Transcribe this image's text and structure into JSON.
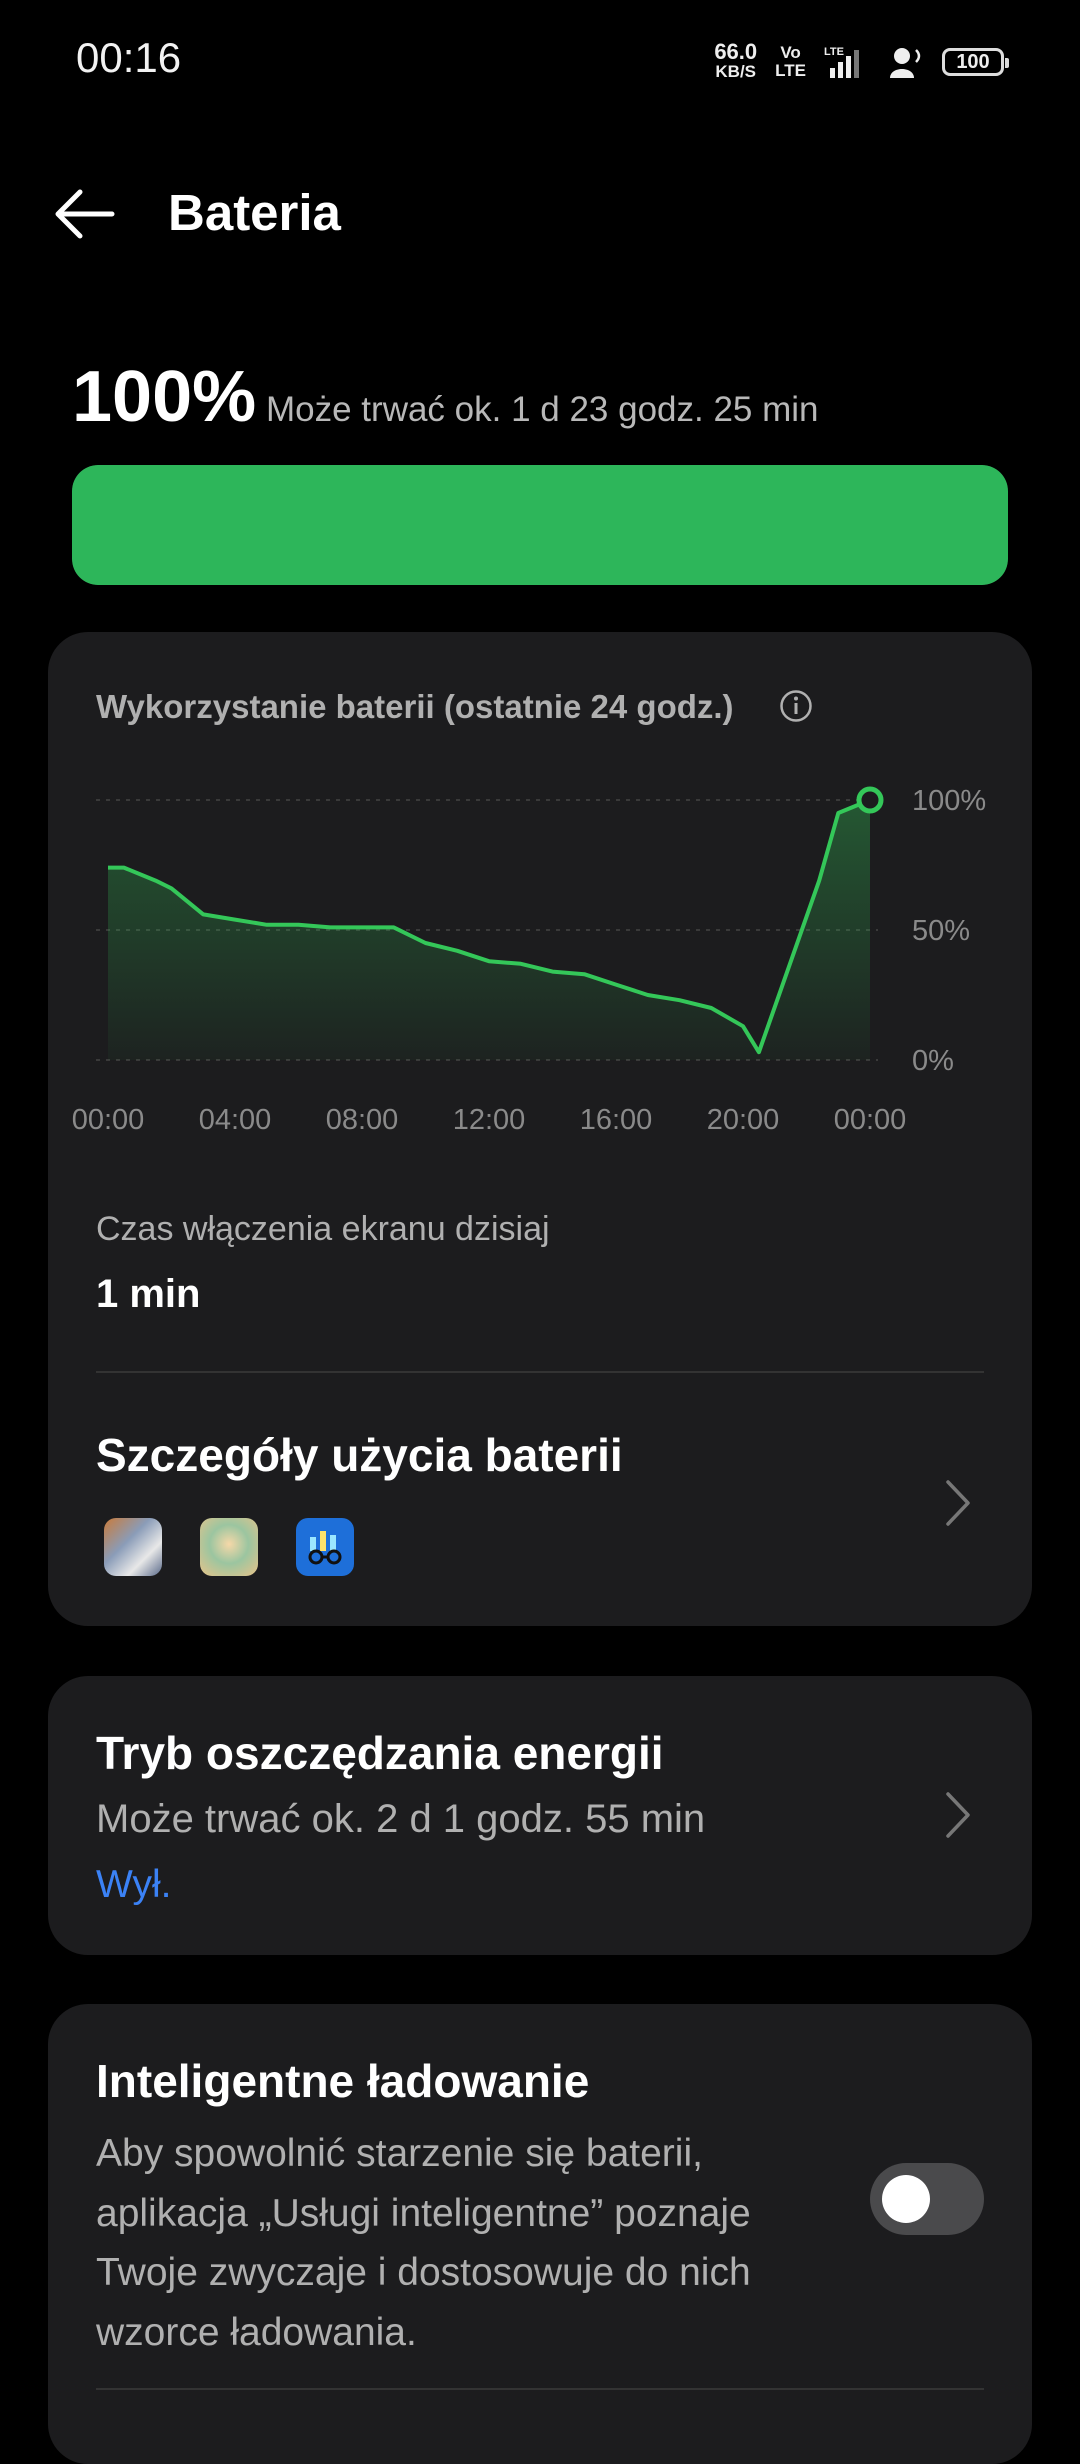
{
  "status_bar": {
    "time": "00:16",
    "net_speed": "66.0",
    "net_unit": "KB/S",
    "volte": "Vo\nLTE",
    "battery": "100"
  },
  "header": {
    "title": "Bateria"
  },
  "battery": {
    "percent": "100%",
    "estimate": "Może trwać ok. 1 d 23 godz. 25 min",
    "level": 1.0,
    "bar_color": "#2db65a"
  },
  "usage": {
    "title": "Wykorzystanie baterii (ostatnie 24 godz.)",
    "screen_on_label": "Czas włączenia ekranu dzisiaj",
    "screen_on_value": "1 min",
    "details_title": "Szczegóły użycia baterii",
    "app_icons": [
      "game-icon-cat",
      "game-icon-character",
      "stats-app-icon"
    ]
  },
  "chart_data": {
    "type": "area",
    "x_labels": [
      "00:00",
      "04:00",
      "08:00",
      "12:00",
      "16:00",
      "20:00",
      "00:00"
    ],
    "y_labels": [
      "100%",
      "50%",
      "0%"
    ],
    "ylim": [
      0,
      100
    ],
    "grid": true,
    "color": "#34c759",
    "series": [
      {
        "x": [
          0,
          0.5,
          1.5,
          2,
          3,
          4,
          5,
          6,
          7,
          9,
          10,
          11,
          12,
          13,
          14,
          15,
          16,
          17,
          18,
          19,
          20,
          20.5,
          22.4,
          23,
          24
        ],
        "values": [
          74,
          74,
          69,
          66,
          56,
          54,
          52,
          52,
          51,
          51,
          45,
          42,
          38,
          37,
          34,
          33,
          29,
          25,
          23,
          20,
          13,
          3,
          69,
          95,
          100
        ]
      }
    ]
  },
  "power_saving": {
    "title": "Tryb oszczędzania energii",
    "subtitle": "Może trwać ok. 2 d 1 godz. 55 min",
    "state": "Wył."
  },
  "smart_charging": {
    "title": "Inteligentne ładowanie",
    "description": "Aby spowolnić starzenie się baterii, aplikacja „Usługi inteligentne” poznaje Twoje zwyczaje i dostosowuje do nich wzorce ładowania.",
    "enabled": false
  }
}
